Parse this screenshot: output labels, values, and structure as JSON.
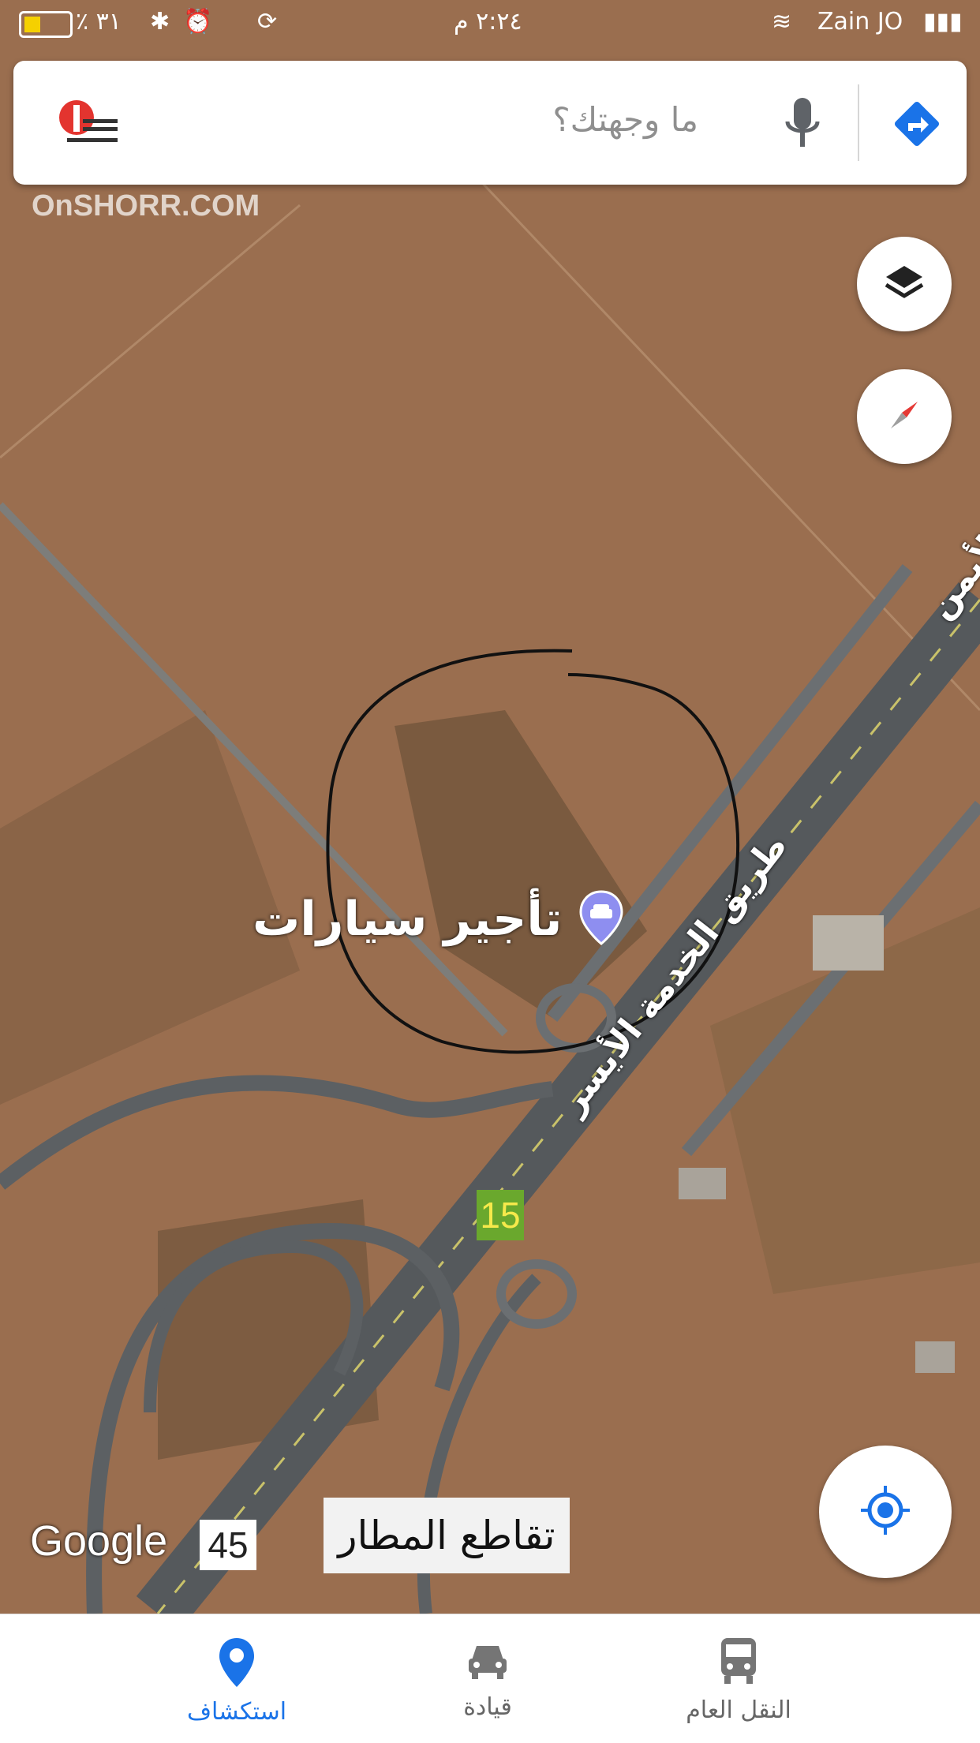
{
  "status_bar": {
    "carrier": "Zain JO",
    "time": "٢:٢٤ م",
    "battery_percent": "٪ ٣١"
  },
  "search": {
    "placeholder": "ما وجهتك؟"
  },
  "map": {
    "place_label": "تأجير سيارات",
    "road_left_service": "طريق الخدمة الأيسر",
    "road_right_partial": "الأيمن",
    "road_badge_15": "15",
    "road_badge_45": "45",
    "junction_label": "تقاطع المطار",
    "google_logo": "Google",
    "watermark": "OnSHORR.COM"
  },
  "bottom_nav": {
    "tabs": [
      {
        "label": "استكشاف",
        "icon": "location-pin-icon",
        "active": true
      },
      {
        "label": "قيادة",
        "icon": "car-icon",
        "active": false
      },
      {
        "label": "النقل العام",
        "icon": "train-icon",
        "active": false
      }
    ]
  },
  "colors": {
    "accent": "#1a73e8",
    "land": "#9a6e4f",
    "road": "#5b5f63",
    "badge_green": "#6aa82d"
  }
}
